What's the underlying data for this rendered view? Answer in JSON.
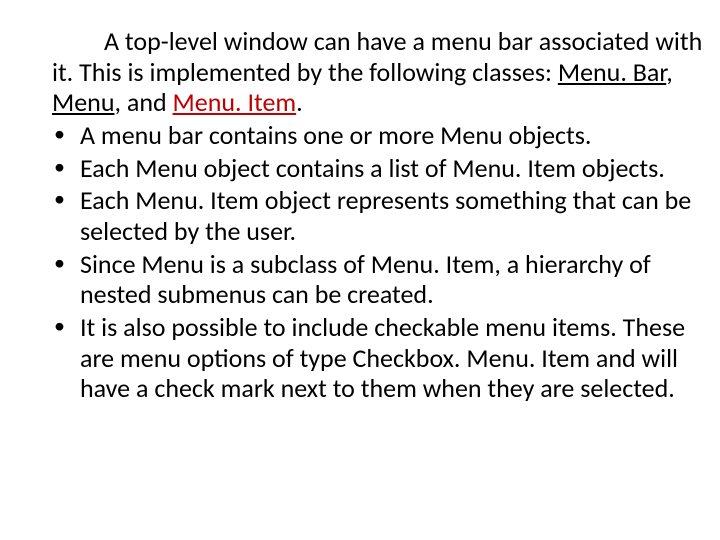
{
  "intro": {
    "pre": "A top-level window can have a menu bar associated with it. This is implemented by the following classes: ",
    "cls1": "Menu. Bar",
    "sep1": ", ",
    "cls2": "Menu",
    "sep2": ", and ",
    "cls3": "Menu. Item",
    "post": "."
  },
  "bullets": [
    "A menu bar contains one or more Menu objects.",
    "Each Menu object contains a list of Menu. Item objects.",
    "Each Menu. Item object represents something that can be selected by the user.",
    "Since Menu is a subclass of Menu. Item, a hierarchy of nested submenus can be created.",
    "It is also possible to include checkable menu items. These are menu options of type Checkbox. Menu. Item and will have a check mark next to them when they are selected."
  ]
}
